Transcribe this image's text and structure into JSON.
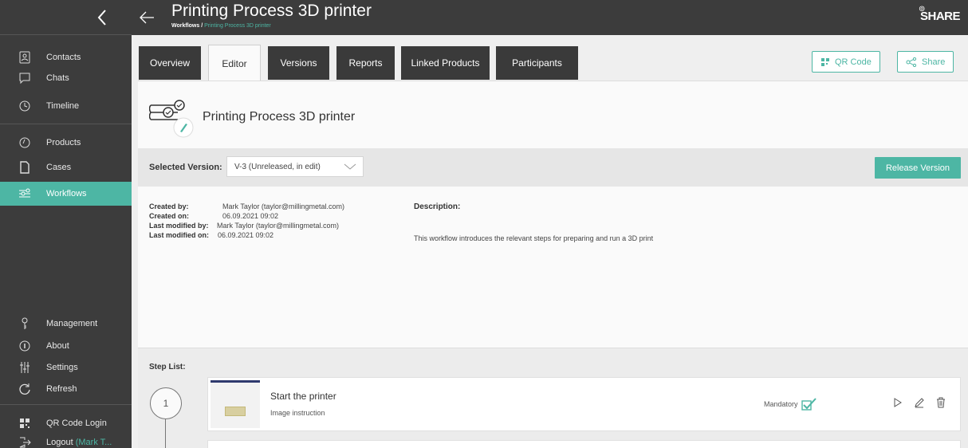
{
  "sidebar": {
    "items": [
      {
        "label": "Contacts",
        "icon": "contacts-icon"
      },
      {
        "label": "Chats",
        "icon": "chat-icon"
      },
      {
        "label": "Timeline",
        "icon": "clock-icon"
      },
      {
        "label": "Products",
        "icon": "products-icon"
      },
      {
        "label": "Cases",
        "icon": "cases-icon"
      },
      {
        "label": "Workflows",
        "icon": "workflows-icon"
      },
      {
        "label": "Management",
        "icon": "key-icon"
      },
      {
        "label": "About",
        "icon": "info-icon"
      },
      {
        "label": "Settings",
        "icon": "settings-sliders-icon"
      },
      {
        "label": "Refresh",
        "icon": "refresh-icon"
      },
      {
        "label": "QR Code Login",
        "icon": "qr-code-icon"
      },
      {
        "label": "Logout",
        "icon": "logout-icon",
        "user": "(Mark T..."
      }
    ]
  },
  "header": {
    "title": "Printing Process 3D printer",
    "breadcrumb_root": "Workflows /",
    "breadcrumb_current": "Printing Process 3D printer",
    "brand": "SHARE"
  },
  "tabs": [
    "Overview",
    "Editor",
    "Versions",
    "Reports",
    "Linked Products",
    "Participants"
  ],
  "toolbar": {
    "qr_label": "QR Code",
    "share_label": "Share"
  },
  "workflow": {
    "name": "Printing Process 3D printer"
  },
  "version": {
    "label": "Selected Version:",
    "selected": "V-3 (Unreleased, in edit)",
    "release_label": "Release Version"
  },
  "meta": {
    "created_by_k": "Created by:",
    "created_by_v": "Mark Taylor (taylor@millingmetal.com)",
    "created_on_k": "Created on:",
    "created_on_v": "06.09.2021 09:02",
    "modified_by_k": "Last modified by:",
    "modified_by_v": "Mark Taylor (taylor@millingmetal.com)",
    "modified_on_k": "Last modified on:",
    "modified_on_v": "06.09.2021 09:02",
    "description_k": "Description:",
    "description_v": "This workflow introduces the relevant steps for preparing and run a 3D print"
  },
  "steps": {
    "label": "Step List:",
    "items": [
      {
        "number": "1",
        "title": "Start the printer",
        "subtitle": "Image instruction",
        "mandatory": "Mandatory"
      }
    ]
  },
  "colors": {
    "accent": "#4db6a4",
    "sidebar": "#3c3c3c"
  }
}
